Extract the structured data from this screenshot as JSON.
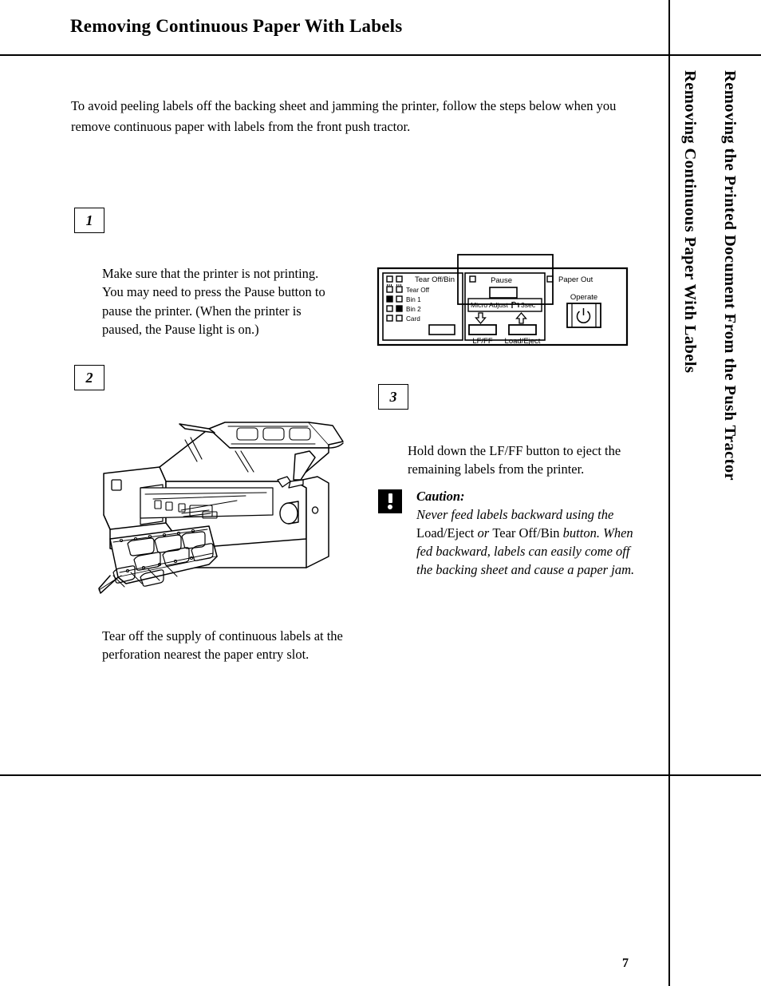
{
  "document": {
    "page_number": "7",
    "title": "Removing Continuous Paper With Labels",
    "intro": "To avoid peeling labels off the backing sheet and jamming the printer, follow the steps below when you remove continuous paper with labels from the front push tractor."
  },
  "side_tab": {
    "outer_label": "Removing the Printed Document From the Push Tractor",
    "inner_label": "Removing Continuous Paper With Labels"
  },
  "steps": [
    {
      "number": "1",
      "text": "Make sure that the printer is not printing. You may need to press the Pause button to pause the printer. (When the printer is paused, the Pause light is on.)"
    },
    {
      "number": "2",
      "caption": "Tear off the supply of continuous labels at the perforation nearest the paper entry slot."
    },
    {
      "number": "3",
      "text": "Hold down the LF/FF button to eject the remaining labels from the printer."
    }
  ],
  "caution": {
    "title": "Caution:",
    "line_1": "Never feed labels backward using the",
    "line_2_roman_a": "Load/Eject",
    "line_2_italic_a": " or ",
    "line_2_roman_b": "Tear Off/Bin",
    "line_2_italic_b": " button. When",
    "line_3": "fed backward, labels can easily come off",
    "line_4": "the backing sheet and cause a paper jam."
  },
  "control_panel": {
    "tear_off_bin_header": "Tear Off/Bin",
    "indicator_rows": [
      {
        "label": "Tear Off",
        "left_state": "hollow",
        "right_state": "hollow"
      },
      {
        "label": "Bin 1",
        "left_state": "filled",
        "right_state": "hollow"
      },
      {
        "label": "Bin 2",
        "left_state": "hollow",
        "right_state": "filled"
      },
      {
        "label": "Card",
        "left_state": "hollow",
        "right_state": "hollow"
      }
    ],
    "pause_label": "Pause",
    "micro_adjust_label": "Micro Adjust",
    "three_sec_label": "3sec",
    "lf_ff_label": "LF/FF",
    "load_eject_label": "Load/Eject",
    "paper_out_label": "Paper Out",
    "operate_label": "Operate",
    "operate_icon": "power-icon"
  },
  "colors": {
    "ink": "#000000",
    "paper": "#ffffff"
  }
}
